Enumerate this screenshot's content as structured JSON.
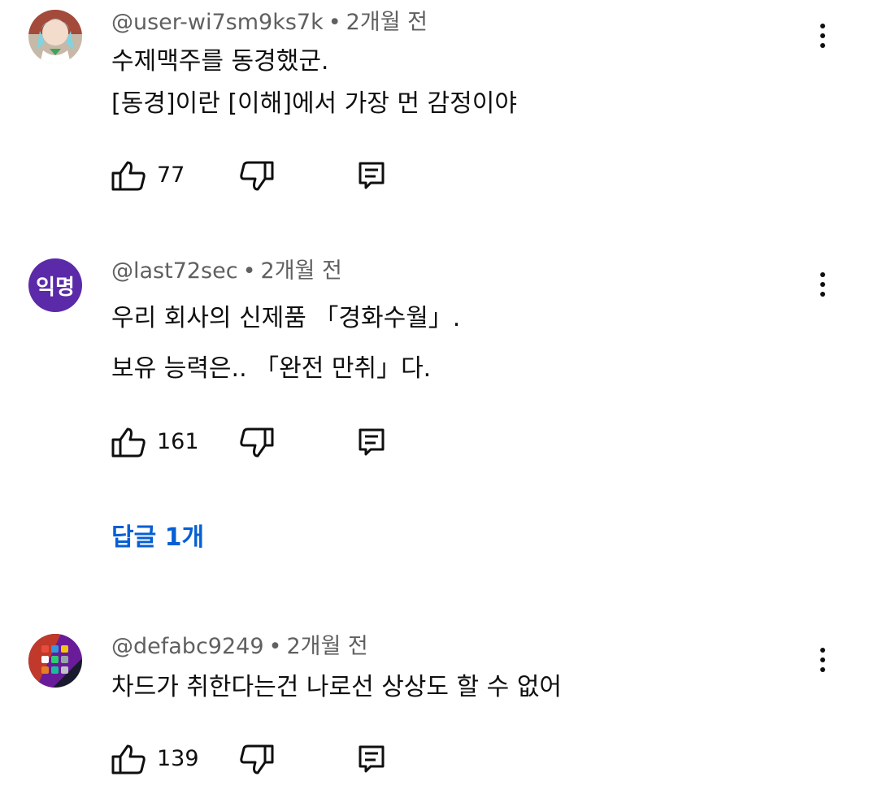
{
  "comments": [
    {
      "author": "@user-wi7sm9ks7k",
      "time": "2개월 전",
      "lines": [
        "수제맥주를 동경했군.",
        "[동경]이란 [이해]에서 가장 먼 감정이야"
      ],
      "likes": "77"
    },
    {
      "author": "@last72sec",
      "time": "2개월 전",
      "avatar_text": "익명",
      "lines": [
        "우리 회사의 신제품 「경화수월」.",
        "보유 능력은.. 「완전 만취」다."
      ],
      "likes": "161",
      "replies_label": "답글 1개"
    },
    {
      "author": "@defabc9249",
      "time": "2개월 전",
      "lines": [
        "차드가 취한다는건 나로선 상상도 할 수 없어"
      ],
      "likes": "139"
    }
  ],
  "meta_separator": "•",
  "colors": {
    "link": "#065fd4",
    "meta": "#606060",
    "avatar_purple": "#5b2aa8"
  }
}
